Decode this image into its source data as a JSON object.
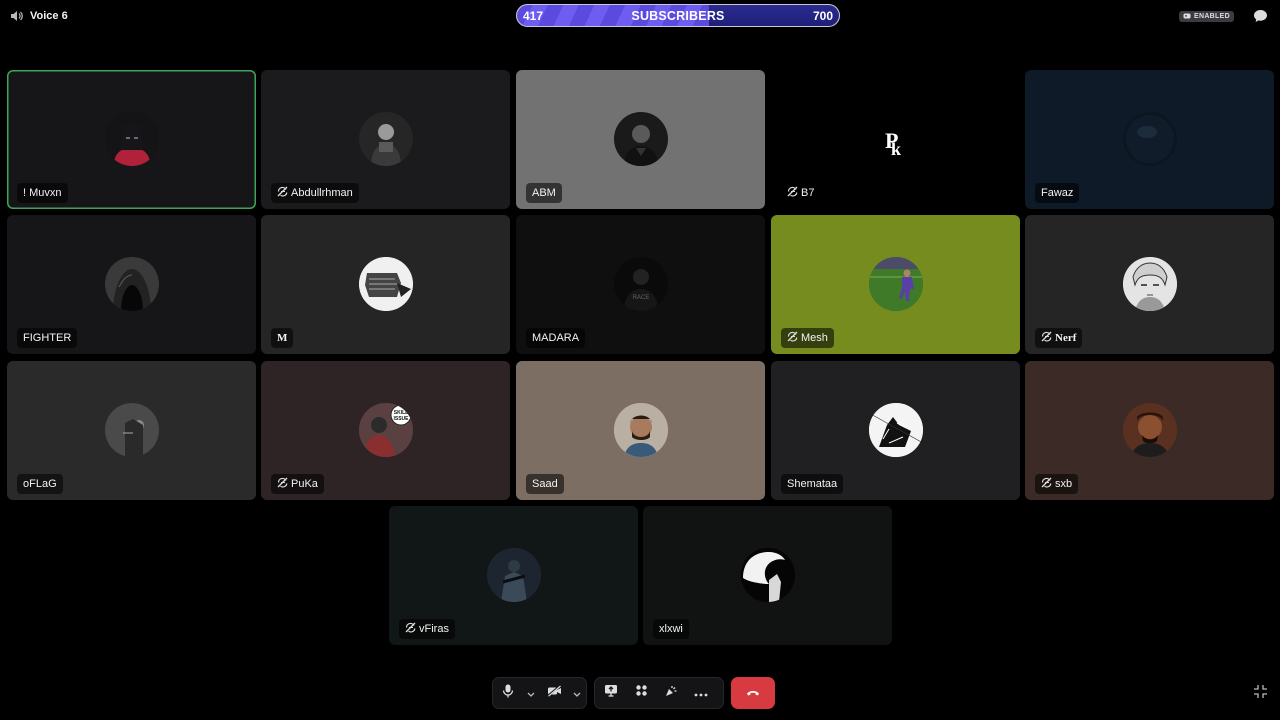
{
  "channel": {
    "name": "Voice 6",
    "icon": "speaker-icon"
  },
  "subscriber_goal": {
    "current": "417",
    "label": "SUBSCRIBERS",
    "goal": "700",
    "progress": 0.5957
  },
  "activity_badge": {
    "label": "ENABLED"
  },
  "colors": {
    "speaking": "#3fa35a",
    "hangup": "#d83a42",
    "fill": "#5b4ae0"
  },
  "participants": [
    {
      "name": "! Muvxn",
      "muted": false,
      "speaking": true,
      "bg": "#161618",
      "avatar": "dark-hooded-figure"
    },
    {
      "name": "Abdullrhman",
      "muted": true,
      "speaking": false,
      "bg": "#1b1b1d",
      "avatar": "grayscale-portrait"
    },
    {
      "name": "ABM",
      "muted": false,
      "speaking": false,
      "bg": "#727272",
      "avatar": "dark-portrait"
    },
    {
      "name": "B7",
      "muted": true,
      "speaking": false,
      "bg": "#000000",
      "avatar": "pk-logo"
    },
    {
      "name": "Fawaz",
      "muted": false,
      "speaking": false,
      "bg": "#0e1a27",
      "avatar": "dark-sphere"
    },
    {
      "name": "FIGHTER",
      "muted": false,
      "speaking": false,
      "bg": "#161618",
      "avatar": "hooded-figure"
    },
    {
      "name": "M",
      "muted": false,
      "speaking": false,
      "bg": "#252526",
      "avatar": "masked-figure"
    },
    {
      "name": "MADARA",
      "muted": false,
      "speaking": false,
      "bg": "#0f0f10",
      "avatar": "dark-character"
    },
    {
      "name": "Mesh",
      "muted": true,
      "speaking": false,
      "bg": "#768c1e",
      "avatar": "football-player"
    },
    {
      "name": "Nerf",
      "muted": true,
      "speaking": false,
      "bg": "#252526",
      "avatar": "manga-character"
    },
    {
      "name": "oFLaG",
      "muted": false,
      "speaking": false,
      "bg": "#2a2a2b",
      "avatar": "dark-figure"
    },
    {
      "name": "PuKa",
      "muted": true,
      "speaking": false,
      "bg": "#2e2325",
      "avatar": "skill-issue"
    },
    {
      "name": "Saad",
      "muted": false,
      "speaking": false,
      "bg": "#7d6e63",
      "avatar": "bearded-man"
    },
    {
      "name": "Shemataa",
      "muted": false,
      "speaking": false,
      "bg": "#202022",
      "avatar": "sketch-wolf"
    },
    {
      "name": "sxb",
      "muted": true,
      "speaking": false,
      "bg": "#3b2a25",
      "avatar": "portrait-warm"
    },
    {
      "name": "vFiras",
      "muted": true,
      "speaking": false,
      "bg": "#111716",
      "avatar": "soldier-figure"
    },
    {
      "name": "xlxwi",
      "muted": false,
      "speaking": false,
      "bg": "#111212",
      "avatar": "silhouette-figure"
    }
  ],
  "controls": {
    "mic": "microphone-icon",
    "camera": "camera-off-icon",
    "share": "screen-share-icon",
    "activities": "activities-icon",
    "soundboard": "soundboard-icon",
    "more": "more-icon",
    "disconnect": "hang-up-icon",
    "shrink": "collapse-icon"
  }
}
